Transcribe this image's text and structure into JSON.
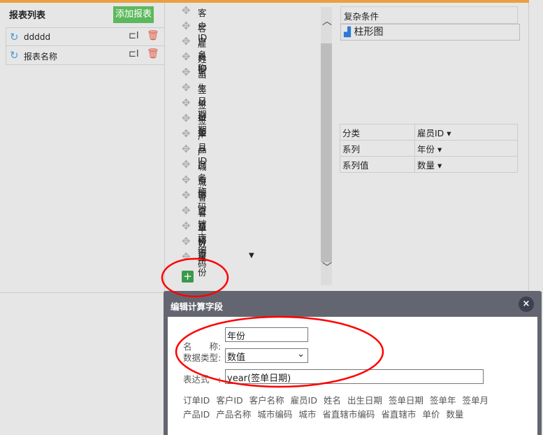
{
  "left": {
    "title": "报表列表",
    "add_button": "添加报表",
    "reports": [
      {
        "name": "ddddd"
      },
      {
        "name": "报表名称"
      }
    ]
  },
  "fields": [
    "客户ID",
    "客户名称",
    "雇员ID",
    "姓名",
    "出生日期",
    "签单日期",
    "签单年",
    "签单月",
    "产品ID",
    "产品名称",
    "城市编码",
    "城市",
    "省直辖市编码",
    "省直辖市",
    "单价",
    "数量",
    "年份"
  ],
  "right": {
    "condition": "复杂条件",
    "chart_type": "柱形图",
    "mapping": [
      {
        "label": "分类",
        "value": "雇员ID"
      },
      {
        "label": "系列",
        "value": "年份"
      },
      {
        "label": "系列值",
        "value": "数量"
      }
    ]
  },
  "dialog": {
    "title": "编辑计算字段",
    "close": "×",
    "name_label": "名　　称:",
    "name_value": "年份",
    "type_label": "数据类型:",
    "type_value": "数值",
    "expr_label": "表达式　:",
    "expr_value": "year(签单日期)",
    "tokens": [
      [
        "订单ID",
        "客户ID",
        "客户名称",
        "雇员ID",
        "姓名",
        "出生日期",
        "签单日期",
        "签单年",
        "签单月"
      ],
      [
        "产品ID",
        "产品名称",
        "城市编码",
        "城市",
        "省直辖市编码",
        "省直辖市",
        "单价",
        "数量"
      ]
    ]
  },
  "colors": {
    "accent": "#e8a040",
    "add_button": "#5cb85c",
    "annotation": "#ff0000"
  }
}
